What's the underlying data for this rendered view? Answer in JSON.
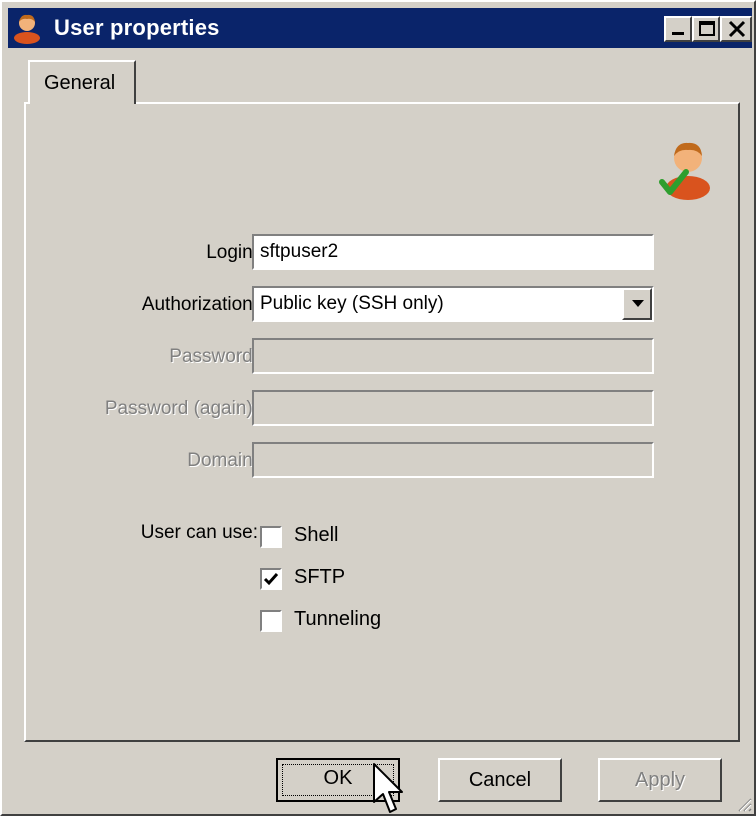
{
  "window": {
    "title": "User properties",
    "icons": {
      "title": "user-icon",
      "minimize": "minimize-icon",
      "maximize": "maximize-icon",
      "close": "close-icon"
    },
    "colors": {
      "titlebar": "#0a246a",
      "face": "#d4d0c8"
    }
  },
  "tabs": [
    {
      "label": "General",
      "selected": true
    }
  ],
  "form": {
    "avatar_icon": "user-check-icon",
    "login": {
      "label": "Login:",
      "value": "sftpuser2"
    },
    "authorization": {
      "label": "Authorization:",
      "value": "Public key (SSH only)"
    },
    "password": {
      "label": "Password:",
      "value": "",
      "enabled": false
    },
    "password_again": {
      "label": "Password (again):",
      "value": "",
      "enabled": false
    },
    "domain": {
      "label": "Domain:",
      "value": "",
      "enabled": false
    },
    "user_can_use": {
      "label": "User can use:",
      "options": [
        {
          "label": "Shell",
          "checked": false
        },
        {
          "label": "SFTP",
          "checked": true
        },
        {
          "label": "Tunneling",
          "checked": false
        }
      ]
    }
  },
  "buttons": {
    "ok": "OK",
    "cancel": "Cancel",
    "apply": "Apply",
    "apply_enabled": false
  }
}
